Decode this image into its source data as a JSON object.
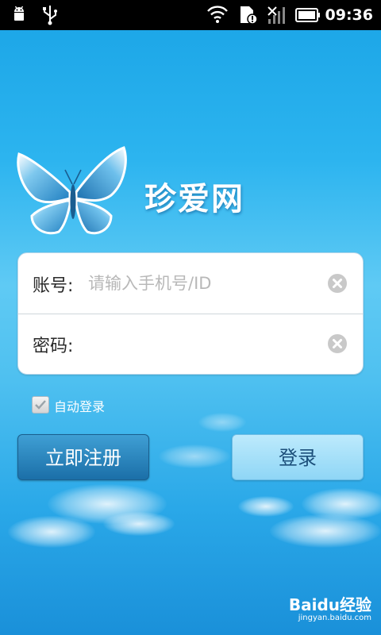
{
  "status_bar": {
    "time": "09:36",
    "icons": [
      "android-debug-icon",
      "usb-icon",
      "wifi-icon",
      "sim-alert-icon",
      "signal-off-icon",
      "battery-icon"
    ]
  },
  "app": {
    "brand_name": "珍爱网",
    "logo_icon": "butterfly-icon"
  },
  "login_form": {
    "account_label": "账号:",
    "account_placeholder": "请输入手机号/ID",
    "account_value": "",
    "password_label": "密码:",
    "password_value": "",
    "clear_icon": "clear-icon"
  },
  "auto_login": {
    "label": "自动登录",
    "checked": true
  },
  "buttons": {
    "register_label": "立即注册",
    "login_label": "登录"
  },
  "watermark": {
    "main": "Baidu经验",
    "sub": "jingyan.baidu.com"
  },
  "colors": {
    "background": "#2cb4ef",
    "register_button": "#1b6fa8",
    "login_button": "#8fd6f6"
  }
}
